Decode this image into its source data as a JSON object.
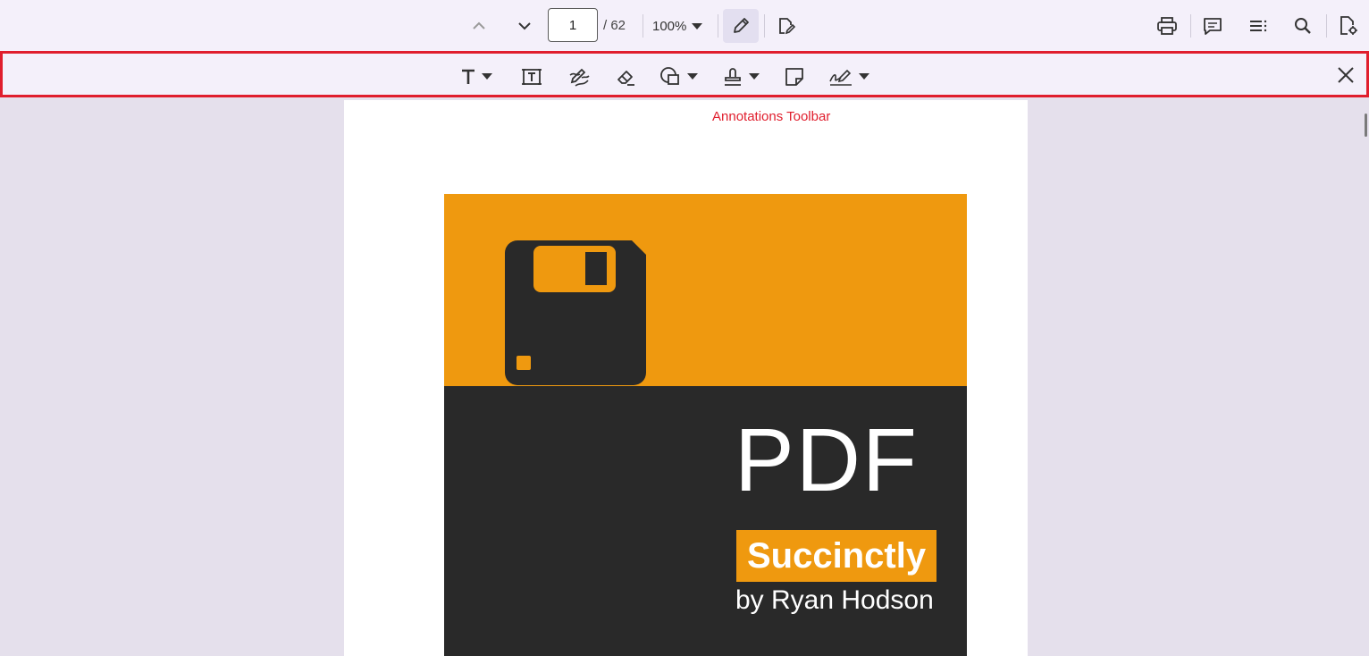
{
  "toolbar": {
    "prev_page_icon": "chevron-up-icon",
    "next_page_icon": "chevron-down-icon",
    "current_page": "1",
    "total_pages": "/ 62",
    "zoom": "100%",
    "edit_icon": "pencil-icon",
    "form_icon": "form-fields-icon",
    "right_icons": [
      "print-icon",
      "comment-icon",
      "bookmark-list-icon",
      "search-icon",
      "document-settings-icon"
    ]
  },
  "annotation_toolbar": {
    "tools": [
      "text-markup-icon",
      "free-text-icon",
      "ink-icon",
      "eraser-icon",
      "shapes-icon",
      "stamp-icon",
      "sticky-note-icon",
      "signature-icon"
    ],
    "close_icon": "close-icon",
    "highlight_color": "#e01e2d"
  },
  "document": {
    "annotation_label": "Annotations Toolbar",
    "cover": {
      "title": "PDF",
      "badge": "Succinctly",
      "author": "by Ryan Hodson",
      "colors": {
        "orange": "#ef990f",
        "dark": "#292929"
      }
    }
  }
}
